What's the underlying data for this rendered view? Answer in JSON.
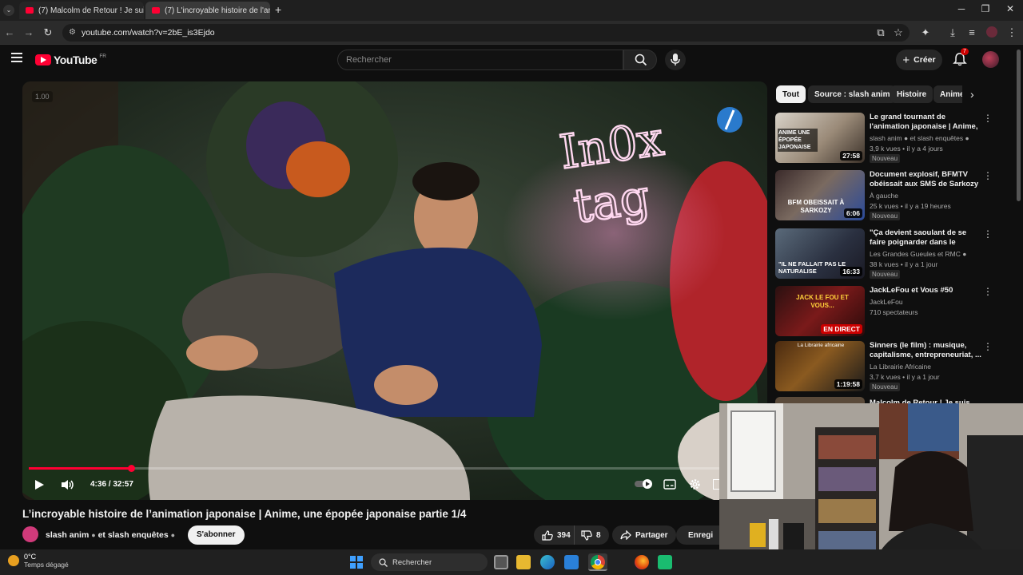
{
  "browser": {
    "tabs": [
      {
        "label": "(7) Malcolm de Retour ! Je suis",
        "active": false
      },
      {
        "label": "(7) L'incroyable histoire de l'ani",
        "active": true
      }
    ],
    "new_tab": "+",
    "url": "youtube.com/watch?v=2bE_is3Ejdo"
  },
  "youtube": {
    "logo_text": "YouTube",
    "region": "FR",
    "search_placeholder": "Rechercher",
    "create_label": "Créer",
    "notif_count": "7"
  },
  "player": {
    "speed_badge": "1.00",
    "time": "4:36 / 32:57",
    "progress": 0.14,
    "overlay_sign_line1": "In0x",
    "overlay_sign_line2": "tag"
  },
  "video": {
    "title": "L’incroyable histoire de l’animation japonaise | Anime, une épopée japonaise partie 1/4",
    "channel": "slash anim",
    "channel_joiner": "et slash enquêtes",
    "subscribe_label": "S'abonner",
    "likes": "394",
    "dislikes": "8",
    "share_label": "Partager",
    "save_label": "Enregi"
  },
  "chips": [
    "Tout",
    "Source : slash anim",
    "Histoire",
    "Anime"
  ],
  "recommendations": [
    {
      "title": "Le grand tournant de l'animation japonaise | Anime, ...",
      "channel": "slash anim ● et slash enquêtes ●",
      "meta": "3,9 k vues • il y a 4 jours",
      "badge": "Nouveau",
      "duration": "27:58",
      "thumb_text": "ANIME UNE ÉPOPÉE JAPONAISE"
    },
    {
      "title": "Document explosif, BFMTV obéissait aux SMS de Sarkozy",
      "channel": "À gauche",
      "meta": "25 k vues • il y a 19 heures",
      "badge": "Nouveau",
      "duration": "6:06",
      "thumb_text": "BFM OBEISSAIT À SARKOZY"
    },
    {
      "title": "\"Ça devient saoulant de se faire poignarder dans le métro\"",
      "channel": "Les Grandes Gueules et RMC ●",
      "meta": "38 k vues • il y a 1 jour",
      "badge": "Nouveau",
      "duration": "16:33",
      "thumb_text": "\"IL NE FALLAIT PAS LE NATURALISE"
    },
    {
      "title": "JackLeFou et Vous #50",
      "channel": "JackLeFou",
      "meta": "710 spectateurs",
      "badge": "",
      "duration": "EN DIRECT",
      "thumb_text": "JACK LE FOU ET VOUS..."
    },
    {
      "title": "Sinners (le film) : musique, capitalisme, entrepreneuriat, ...",
      "channel": "La Librairie Africaine",
      "meta": "3,7 k vues • il y a 1 jour",
      "badge": "Nouveau",
      "duration": "1:19:58",
      "thumb_text": "La Librairie africaine"
    },
    {
      "title": "Malcolm de Retour ! Je suis",
      "channel": "",
      "meta": "",
      "badge": "",
      "duration": "",
      "thumb_text": ""
    }
  ],
  "taskbar": {
    "weather_temp": "0°C",
    "weather_desc": "Temps dégagé",
    "search_label": "Rechercher"
  },
  "colors": {
    "accent": "#ff0033",
    "bg": "#0f0f0f"
  }
}
